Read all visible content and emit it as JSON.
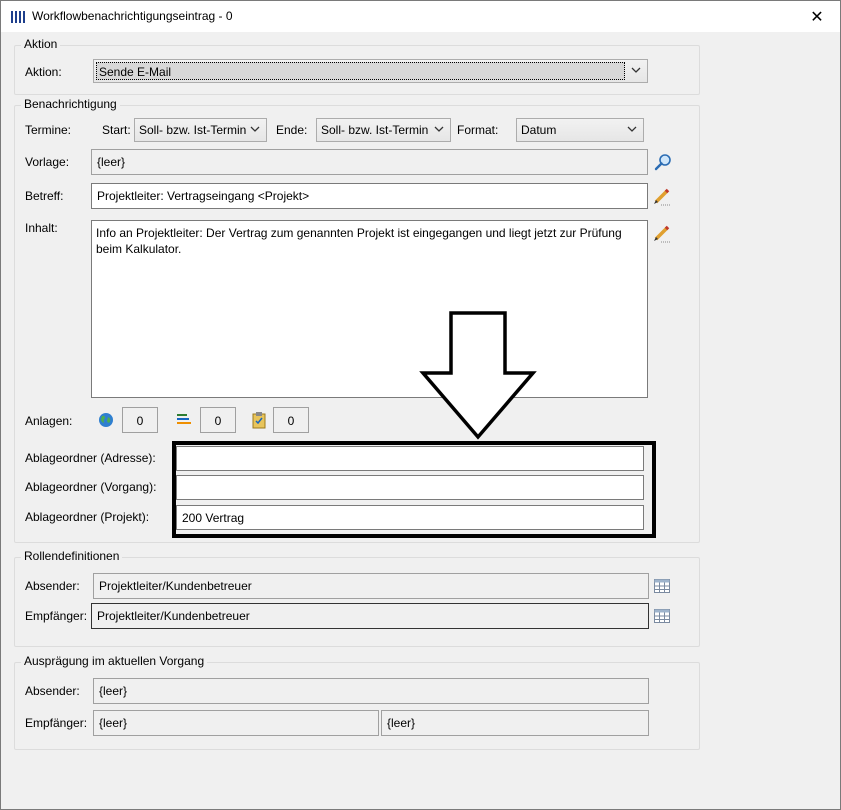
{
  "window": {
    "title": "Workflowbenachrichtigungseintrag - 0",
    "close_label": "✕"
  },
  "aktion": {
    "group_label": "Aktion",
    "label": "Aktion:",
    "value": "Sende E-Mail"
  },
  "benachrichtigung": {
    "group_label": "Benachrichtigung",
    "termine_label": "Termine:",
    "start_label": "Start:",
    "start_value": "Soll- bzw. Ist-Termin",
    "ende_label": "Ende:",
    "ende_value": "Soll- bzw. Ist-Termin",
    "format_label": "Format:",
    "format_value": "Datum",
    "vorlage_label": "Vorlage:",
    "vorlage_value": "{leer}",
    "betreff_label": "Betreff:",
    "betreff_value": "Projektleiter: Vertragseingang <Projekt>",
    "inhalt_label": "Inhalt:",
    "inhalt_value": "Info an Projektleiter: Der Vertrag zum genannten Projekt ist eingegangen und liegt jetzt zur Prüfung beim Kalkulator.",
    "anlagen_label": "Anlagen:",
    "anlagen_counts": [
      "0",
      "0",
      "0"
    ],
    "ablage_adresse_label": "Ablageordner (Adresse):",
    "ablage_adresse_value": "",
    "ablage_vorgang_label": "Ablageordner (Vorgang):",
    "ablage_vorgang_value": "",
    "ablage_projekt_label": "Ablageordner (Projekt):",
    "ablage_projekt_value": "200 Vertrag"
  },
  "rollen": {
    "group_label": "Rollendefinitionen",
    "absender_label": "Absender:",
    "absender_value": "Projektleiter/Kundenbetreuer",
    "empfaenger_label": "Empfänger:",
    "empfaenger_value": "Projektleiter/Kundenbetreuer"
  },
  "auspraegung": {
    "group_label": "Ausprägung im aktuellen Vorgang",
    "absender_label": "Absender:",
    "absender_value": "{leer}",
    "empfaenger_label": "Empfänger:",
    "empfaenger_value_1": "{leer}",
    "empfaenger_value_2": "{leer}"
  },
  "icons": [
    "app-icon",
    "close-icon",
    "chevron-down-icon",
    "search-icon",
    "pencil-icon",
    "globe-icon",
    "list-icon",
    "clipboard-icon",
    "table-icon",
    "down-arrow-annotation"
  ]
}
